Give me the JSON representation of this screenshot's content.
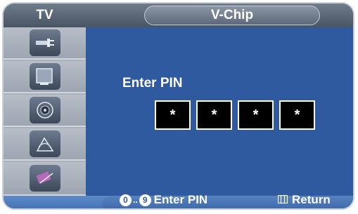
{
  "header": {
    "left_title": "TV",
    "title": "V-Chip"
  },
  "sidebar": {
    "items": [
      {
        "icon": "input-plug-icon"
      },
      {
        "icon": "picture-screen-icon"
      },
      {
        "icon": "speaker-icon"
      },
      {
        "icon": "antenna-dish-icon"
      },
      {
        "icon": "setup-connector-icon"
      }
    ]
  },
  "main": {
    "prompt": "Enter PIN",
    "pin_digits": [
      "*",
      "*",
      "*",
      "*"
    ]
  },
  "footer": {
    "key_from": "0",
    "key_sep": "..",
    "key_to": "9",
    "enter_label": "Enter PIN",
    "return_label": "Return"
  }
}
